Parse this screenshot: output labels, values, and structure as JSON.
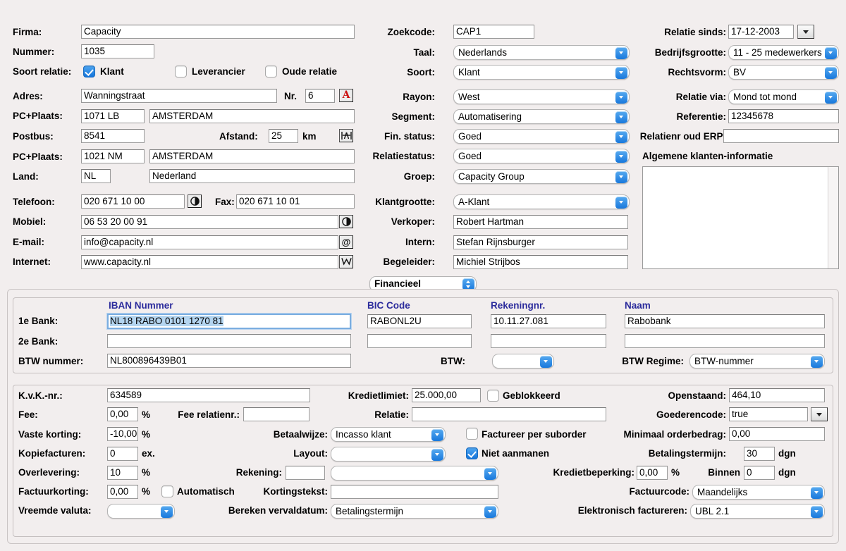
{
  "left": {
    "firma": {
      "label": "Firma:",
      "value": "Capacity"
    },
    "nummer": {
      "label": "Nummer:",
      "value": "1035"
    },
    "soort_relatie": {
      "label": "Soort relatie:",
      "options": [
        {
          "label": "Klant",
          "checked": true
        },
        {
          "label": "Leverancier",
          "checked": false
        },
        {
          "label": "Oude relatie",
          "checked": false
        }
      ]
    },
    "adres": {
      "label": "Adres:",
      "value": "Wanningstraat",
      "nr_label": "Nr.",
      "nr_value": "6",
      "icon": "letter-a-icon"
    },
    "pcplaats1": {
      "label": "PC+Plaats:",
      "zip": "1071 LB",
      "city": "AMSTERDAM"
    },
    "postbus": {
      "label": "Postbus:",
      "value": "8541",
      "afstand_label": "Afstand:",
      "afstand_value": "25",
      "unit": "km",
      "icon": "distance-icon"
    },
    "pcplaats2": {
      "label": "PC+Plaats:",
      "zip": "1021 NM",
      "city": "AMSTERDAM"
    },
    "land": {
      "label": "Land:",
      "code": "NL",
      "name": "Nederland"
    },
    "telefoon": {
      "label": "Telefoon:",
      "value": "020 671 10 00",
      "icon": "dial-icon",
      "fax_label": "Fax:",
      "fax_value": "020 671 10 01"
    },
    "mobiel": {
      "label": "Mobiel:",
      "value": "06 53 20 00 91",
      "icon": "dial-icon"
    },
    "email": {
      "label": "E-mail:",
      "value": "info@capacity.nl",
      "icon": "at-icon"
    },
    "internet": {
      "label": "Internet:",
      "value": "www.capacity.nl",
      "icon": "web-icon"
    }
  },
  "mid": {
    "zoekcode": {
      "label": "Zoekcode:",
      "value": "CAP1"
    },
    "taal": {
      "label": "Taal:",
      "value": "Nederlands"
    },
    "soort": {
      "label": "Soort:",
      "value": "Klant"
    },
    "rayon": {
      "label": "Rayon:",
      "value": "West"
    },
    "segment": {
      "label": "Segment:",
      "value": "Automatisering"
    },
    "fin_status": {
      "label": "Fin. status:",
      "value": "Goed"
    },
    "relatiestatus": {
      "label": "Relatiestatus:",
      "value": "Goed"
    },
    "groep": {
      "label": "Groep:",
      "value": "Capacity Group"
    },
    "klantgrootte": {
      "label": "Klantgrootte:",
      "value": "A-Klant"
    },
    "verkoper": {
      "label": "Verkoper:",
      "value": "Robert Hartman"
    },
    "intern": {
      "label": "Intern:",
      "value": "Stefan Rijnsburger"
    },
    "begeleider": {
      "label": "Begeleider:",
      "value": "Michiel Strijbos"
    }
  },
  "right": {
    "relatie_sinds": {
      "label": "Relatie sinds:",
      "value": "17-12-2003"
    },
    "bedrijfsgrootte": {
      "label": "Bedrijfsgrootte:",
      "value": "11 - 25 medewerkers"
    },
    "rechtsvorm": {
      "label": "Rechtsvorm:",
      "value": "BV"
    },
    "relatie_via": {
      "label": "Relatie via:",
      "value": "Mond tot mond"
    },
    "referentie": {
      "label": "Referentie:",
      "value": "12345678"
    },
    "relatienr_oud_erp": {
      "label": "Relatienr oud ERP:",
      "value": ""
    },
    "algemene_info": {
      "label": "Algemene klanten-informatie",
      "value": ""
    }
  },
  "tab": {
    "label": "Financieel"
  },
  "bank": {
    "columns": {
      "iban": "IBAN Nummer",
      "bic": "BIC Code",
      "rekening": "Rekeningnr.",
      "naam": "Naam"
    },
    "rows": [
      {
        "label": "1e Bank:",
        "iban": "NL18 RABO 0101 1270 81",
        "bic": "RABONL2U",
        "rekening": "10.11.27.081",
        "naam": "Rabobank",
        "focused": true
      },
      {
        "label": "2e Bank:",
        "iban": "",
        "bic": "",
        "rekening": "",
        "naam": "",
        "focused": false
      }
    ],
    "btw_nummer": {
      "label": "BTW nummer:",
      "value": "NL800896439B01"
    },
    "btw": {
      "label": "BTW:",
      "value": ""
    },
    "btw_regime": {
      "label": "BTW Regime:",
      "value": "BTW-nummer"
    }
  },
  "fin": {
    "kvk": {
      "label": "K.v.K.-nr.:",
      "value": "634589"
    },
    "fee": {
      "label": "Fee:",
      "value": "0,00",
      "unit": "%"
    },
    "fee_relatienr": {
      "label": "Fee relatienr.:",
      "value": ""
    },
    "vaste_korting": {
      "label": "Vaste korting:",
      "value": "-10,00",
      "unit": "%"
    },
    "kopiefacturen": {
      "label": "Kopiefacturen:",
      "value": "0",
      "unit": "ex."
    },
    "overlevering": {
      "label": "Overlevering:",
      "value": "10",
      "unit": "%"
    },
    "factuurkorting": {
      "label": "Factuurkorting:",
      "value": "0,00",
      "unit": "%"
    },
    "automatisch": {
      "label": "Automatisch",
      "checked": false
    },
    "vreemde_valuta": {
      "label": "Vreemde valuta:",
      "value": ""
    },
    "kredietlimiet": {
      "label": "Kredietlimiet:",
      "value": "25.000,00"
    },
    "geblokkeerd": {
      "label": "Geblokkeerd",
      "checked": false
    },
    "relatie": {
      "label": "Relatie:",
      "value": ""
    },
    "betaalwijze": {
      "label": "Betaalwijze:",
      "value": "Incasso klant"
    },
    "factureer_per_suborder": {
      "label": "Factureer per suborder",
      "checked": false
    },
    "layout": {
      "label": "Layout:",
      "value": ""
    },
    "niet_aanmanen": {
      "label": "Niet aanmanen",
      "checked": true
    },
    "rekening": {
      "label": "Rekening:",
      "value": "",
      "value2": ""
    },
    "kredietbeperking": {
      "label": "Kredietbeperking:",
      "value": "0,00",
      "unit": "%"
    },
    "binnen": {
      "label": "Binnen",
      "value": "0",
      "unit": "dgn"
    },
    "kortingstekst": {
      "label": "Kortingstekst:",
      "value": ""
    },
    "bereken_vervaldatum": {
      "label": "Bereken vervaldatum:",
      "value": "Betalingstermijn"
    },
    "openstaand": {
      "label": "Openstaand:",
      "value": "464,10"
    },
    "goederencode": {
      "label": "Goederencode:",
      "value": "true"
    },
    "minimaal_orderbedrag": {
      "label": "Minimaal orderbedrag:",
      "value": "0,00"
    },
    "betalingstermijn": {
      "label": "Betalingstermijn:",
      "value": "30",
      "unit": "dgn"
    },
    "factuurcode": {
      "label": "Factuurcode:",
      "value": "Maandelijks"
    },
    "elektronisch_factureren": {
      "label": "Elektronisch factureren:",
      "value": "UBL 2.1"
    }
  },
  "colors": {
    "accent": "#1878dc",
    "header_text": "#2b2b9c",
    "selection": "#b4d5f0",
    "red_icon": "#cc1111"
  }
}
